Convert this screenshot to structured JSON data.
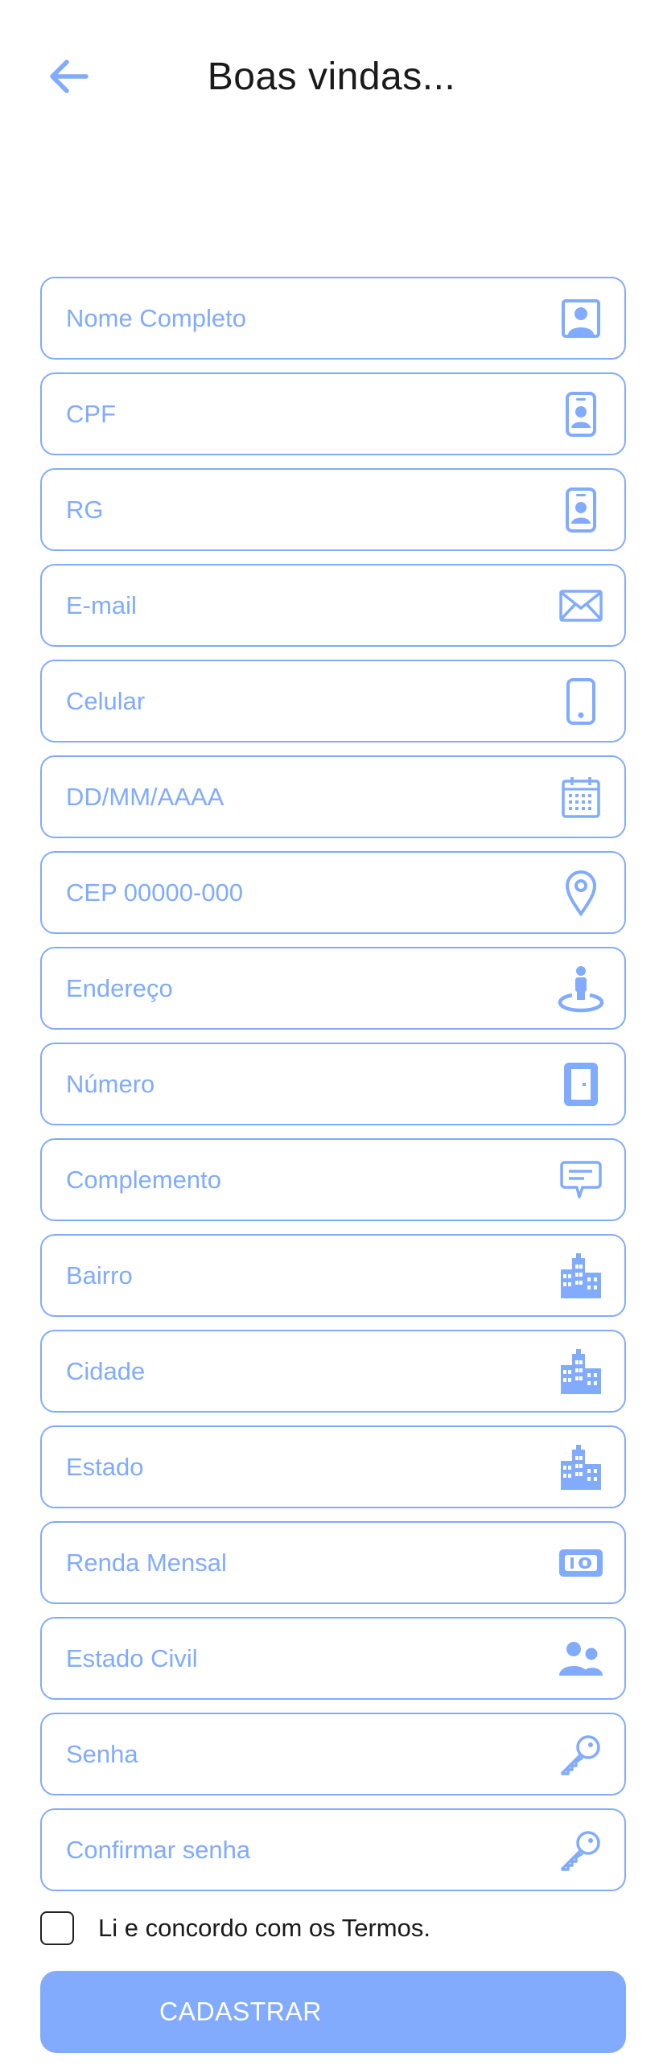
{
  "header": {
    "title": "Boas vindas...",
    "back_icon": "arrow-left-icon"
  },
  "fields": [
    {
      "name": "nome",
      "placeholder": "Nome Completo",
      "icon": "contact-card-icon"
    },
    {
      "name": "cpf",
      "placeholder": "CPF",
      "icon": "id-badge-icon"
    },
    {
      "name": "rg",
      "placeholder": "RG",
      "icon": "id-badge-icon"
    },
    {
      "name": "email",
      "placeholder": "E-mail",
      "icon": "envelope-icon"
    },
    {
      "name": "celular",
      "placeholder": "Celular",
      "icon": "smartphone-icon"
    },
    {
      "name": "data",
      "placeholder": "DD/MM/AAAA",
      "icon": "calendar-icon"
    },
    {
      "name": "cep",
      "placeholder": "CEP 00000-000",
      "icon": "map-pin-icon"
    },
    {
      "name": "endereco",
      "placeholder": "Endereço",
      "icon": "street-view-icon"
    },
    {
      "name": "numero",
      "placeholder": "Número",
      "icon": "door-icon"
    },
    {
      "name": "complemento",
      "placeholder": "Complemento",
      "icon": "comment-icon"
    },
    {
      "name": "bairro",
      "placeholder": "Bairro",
      "icon": "city-icon"
    },
    {
      "name": "cidade",
      "placeholder": "Cidade",
      "icon": "city-icon"
    },
    {
      "name": "estado",
      "placeholder": "Estado",
      "icon": "city-icon"
    },
    {
      "name": "renda",
      "placeholder": "Renda Mensal",
      "icon": "money-bill-icon"
    },
    {
      "name": "estado-civil",
      "placeholder": "Estado Civil",
      "icon": "user-friends-icon"
    },
    {
      "name": "senha",
      "placeholder": "Senha",
      "icon": "key-icon"
    },
    {
      "name": "confirmar-senha",
      "placeholder": "Confirmar senha",
      "icon": "key-icon"
    }
  ],
  "terms": {
    "label": "Li e concordo com os Termos.",
    "checked": false
  },
  "submit": {
    "label": "CADASTRAR"
  },
  "colors": {
    "accent": "#80abff",
    "button": "#82abfe",
    "text": "#1a1a1a"
  }
}
